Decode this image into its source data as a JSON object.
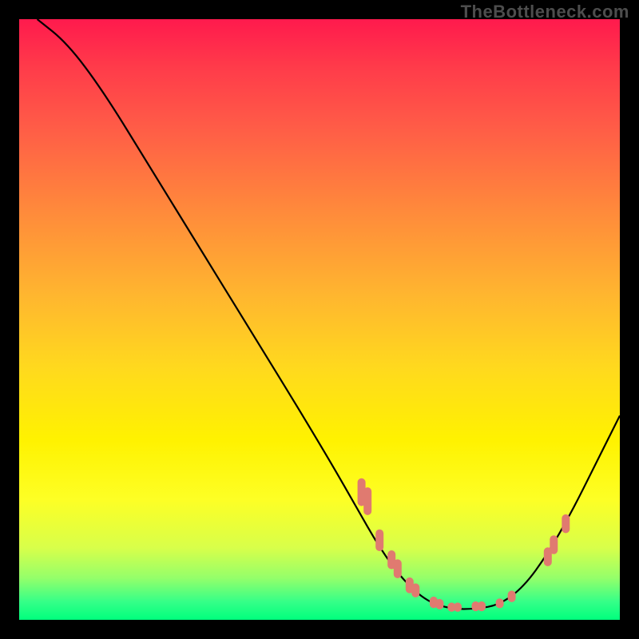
{
  "watermark": "TheBottleneck.com",
  "colors": {
    "curve": "#000000",
    "marker_fill": "#e07a70",
    "marker_stroke": "#e07a70"
  },
  "chart_data": {
    "type": "line",
    "title": "",
    "xlabel": "",
    "ylabel": "",
    "xlim": [
      0,
      100
    ],
    "ylim": [
      0,
      100
    ],
    "curve": [
      {
        "x": 3,
        "y": 100
      },
      {
        "x": 8,
        "y": 96
      },
      {
        "x": 14,
        "y": 88
      },
      {
        "x": 22,
        "y": 75
      },
      {
        "x": 30,
        "y": 62
      },
      {
        "x": 38,
        "y": 49
      },
      {
        "x": 46,
        "y": 36
      },
      {
        "x": 52,
        "y": 26
      },
      {
        "x": 56,
        "y": 19
      },
      {
        "x": 60,
        "y": 12
      },
      {
        "x": 64,
        "y": 6.5
      },
      {
        "x": 68,
        "y": 3
      },
      {
        "x": 72,
        "y": 1.8
      },
      {
        "x": 76,
        "y": 1.8
      },
      {
        "x": 80,
        "y": 2.5
      },
      {
        "x": 84,
        "y": 5.5
      },
      {
        "x": 88,
        "y": 11
      },
      {
        "x": 92,
        "y": 18
      },
      {
        "x": 96,
        "y": 26
      },
      {
        "x": 100,
        "y": 34
      }
    ],
    "markers": [
      {
        "x": 57,
        "y_top": 23.5,
        "y_bot": 19.0
      },
      {
        "x": 58,
        "y_top": 22.0,
        "y_bot": 17.5
      },
      {
        "x": 60,
        "y_top": 15.0,
        "y_bot": 11.5
      },
      {
        "x": 62,
        "y_top": 11.5,
        "y_bot": 8.5
      },
      {
        "x": 63,
        "y_top": 10.0,
        "y_bot": 7.0
      },
      {
        "x": 65,
        "y_top": 7.0,
        "y_bot": 4.5
      },
      {
        "x": 66,
        "y_top": 6.0,
        "y_bot": 3.8
      },
      {
        "x": 69,
        "y_top": 3.8,
        "y_bot": 2.0
      },
      {
        "x": 70,
        "y_top": 3.4,
        "y_bot": 1.8
      },
      {
        "x": 72,
        "y_top": 2.8,
        "y_bot": 1.4
      },
      {
        "x": 73,
        "y_top": 2.8,
        "y_bot": 1.4
      },
      {
        "x": 76,
        "y_top": 3.0,
        "y_bot": 1.5
      },
      {
        "x": 77,
        "y_top": 3.0,
        "y_bot": 1.5
      },
      {
        "x": 80,
        "y_top": 3.5,
        "y_bot": 2.0
      },
      {
        "x": 82,
        "y_top": 4.8,
        "y_bot": 3.0
      },
      {
        "x": 88,
        "y_top": 12.0,
        "y_bot": 9.0
      },
      {
        "x": 89,
        "y_top": 14.0,
        "y_bot": 11.0
      },
      {
        "x": 91,
        "y_top": 17.5,
        "y_bot": 14.5
      }
    ]
  }
}
